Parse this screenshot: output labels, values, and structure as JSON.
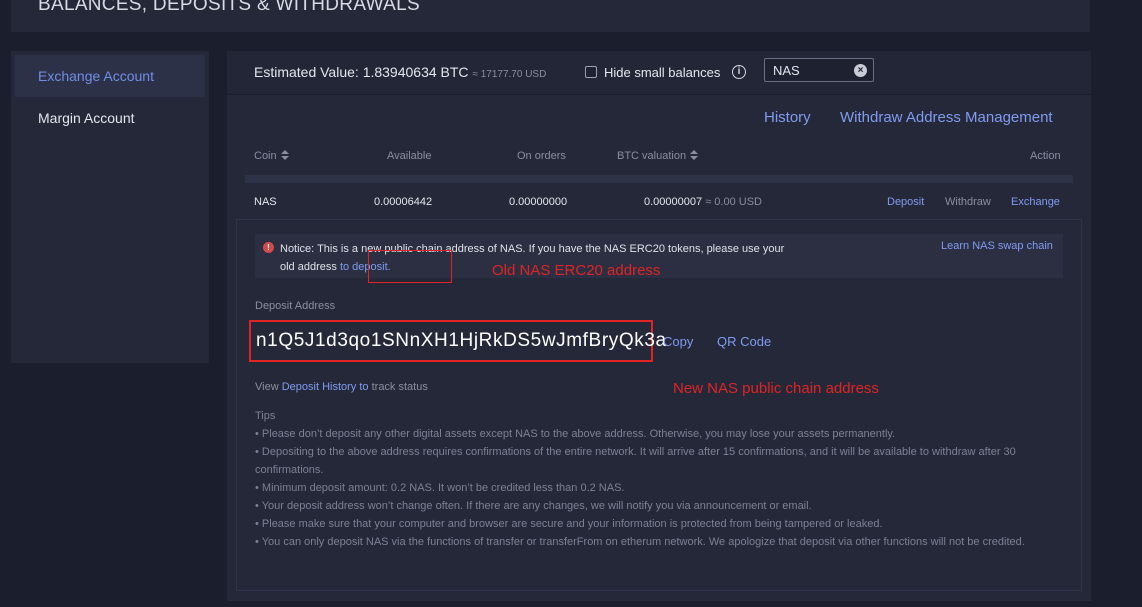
{
  "header": {
    "title": "BALANCES, DEPOSITS & WITHDRAWALS"
  },
  "sidebar": {
    "items": [
      {
        "label": "Exchange Account",
        "active": true
      },
      {
        "label": "Margin Account",
        "active": false
      }
    ]
  },
  "estimate": {
    "label": "Estimated Value:",
    "btc": "1.83940634 BTC",
    "usd": "≈ 17177.70 USD",
    "hide_small": "Hide small balances",
    "search_value": "NAS"
  },
  "links": {
    "history": "History",
    "withdraw_management": "Withdraw Address Management"
  },
  "columns": {
    "coin": "Coin",
    "available": "Available",
    "on_orders": "On orders",
    "btc_valuation": "BTC valuation",
    "action": "Action"
  },
  "row": {
    "coin": "NAS",
    "available": "0.00006442",
    "on_orders": "0.00000000",
    "btc": "0.00000007",
    "usd": "≈ 0.00 USD",
    "deposit": "Deposit",
    "withdraw": "Withdraw",
    "exchange": "Exchange"
  },
  "notice": {
    "text_before": "Notice: This is a new public chain address of NAS. If you have the NAS ERC20 tokens, please use your old address",
    "link": "to deposit.",
    "learn": "Learn NAS swap chain"
  },
  "annotations": {
    "old": "Old NAS ERC20 address",
    "new": "New NAS public chain address"
  },
  "deposit": {
    "label": "Deposit Address",
    "address": "n1Q5J1d3qo1SNnXH1HjRkDS5wJmfBryQk3a",
    "copy": "Copy",
    "qr": "QR Code",
    "view_prefix": "View",
    "history_link": "Deposit History to",
    "view_suffix": "track status"
  },
  "tips": {
    "title": "Tips",
    "items": [
      "• Please don’t deposit any other digital assets except NAS to the above address. Otherwise, you may lose your assets permanently.",
      "• Depositing to the above address requires confirmations of the entire network. It will arrive after 15 confirmations, and it will be available to withdraw after 30 confirmations.",
      "• Minimum deposit amount: 0.2 NAS. It won’t be credited less than 0.2 NAS.",
      "• Your deposit address won’t change often. If there are any changes, we will notify you via announcement or email.",
      "• Please make sure that your computer and browser are secure and your information is protected from being tampered or leaked.",
      "• You can only deposit NAS via the functions of transfer or transferFrom on etherum network. We apologize that deposit via other functions will not be credited."
    ]
  },
  "colors": {
    "accent": "#7f9cf0",
    "annotation_red": "#e02424",
    "panel": "#252839",
    "background": "#1b1e2d"
  }
}
